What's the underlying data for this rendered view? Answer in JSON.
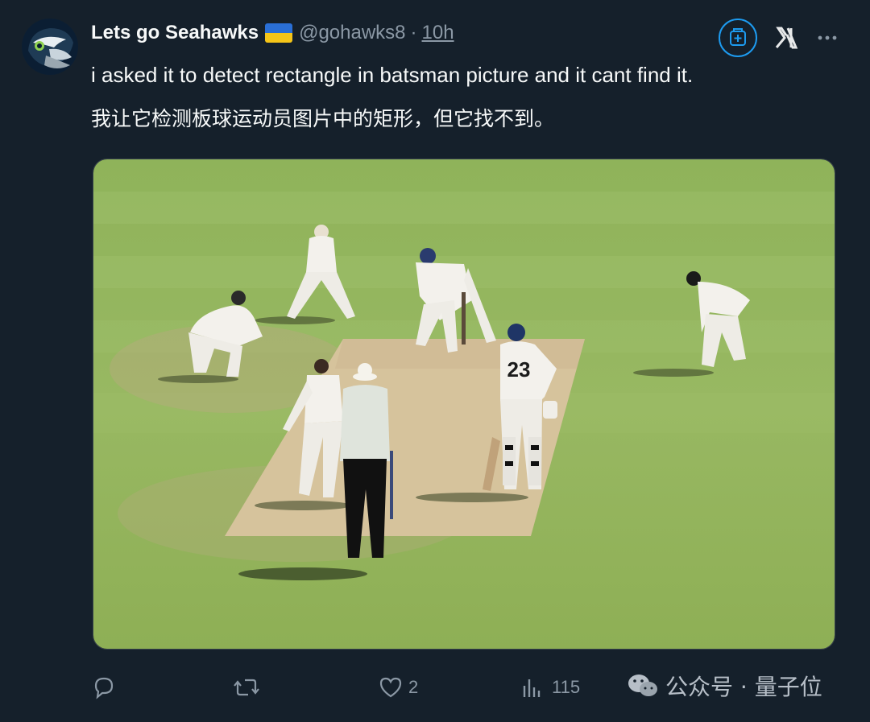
{
  "user": {
    "display_name": "Lets go Seahawks",
    "flag_icon": "ukraine-flag-icon",
    "handle": "@gohawks8",
    "separator": "·",
    "time": "10h"
  },
  "tweet": {
    "line1": "i asked it to detect rectangle in batsman picture and it cant find it.",
    "line2": "我让它检测板球运动员图片中的矩形，但它找不到。"
  },
  "media": {
    "player_number": "23"
  },
  "actions": {
    "reply_icon": "reply-icon",
    "retweet_icon": "retweet-icon",
    "like_count": "2",
    "views_count": "115"
  },
  "watermark": {
    "text": "公众号 · 量子位"
  },
  "colors": {
    "background": "#15202b",
    "accent": "#1d9bf0",
    "muted": "#8b98a5"
  }
}
